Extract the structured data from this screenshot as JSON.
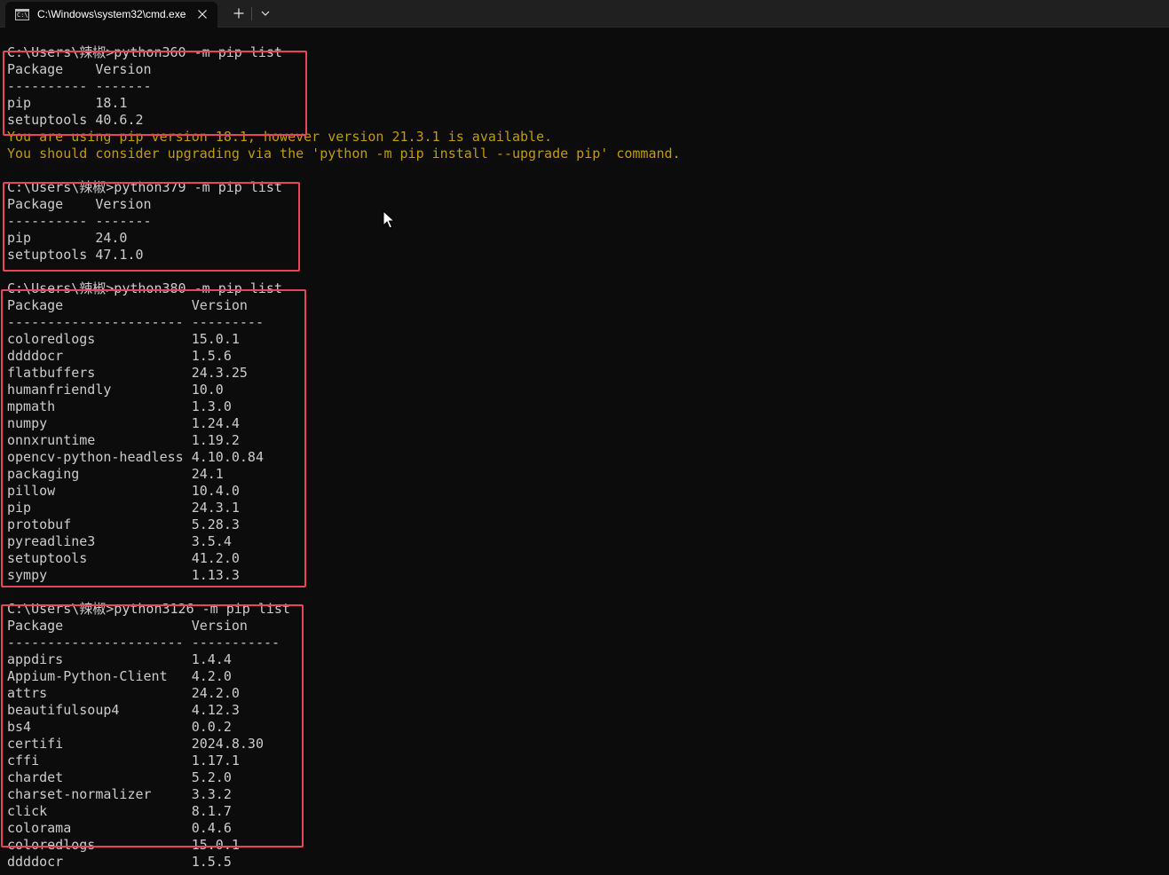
{
  "window": {
    "tab_title": "C:\\Windows\\system32\\cmd.exe"
  },
  "terminal": {
    "lines": [
      "",
      "C:\\Users\\辣椒>python360 -m pip list",
      "Package    Version",
      "---------- -------",
      "pip        18.1",
      "setuptools 40.6.2",
      "You are using pip version 18.1, however version 21.3.1 is available.",
      "You should consider upgrading via the 'python -m pip install --upgrade pip' command.",
      "",
      "C:\\Users\\辣椒>python379 -m pip list",
      "Package    Version",
      "---------- -------",
      "pip        24.0",
      "setuptools 47.1.0",
      "",
      "C:\\Users\\辣椒>python380 -m pip list",
      "Package                Version",
      "---------------------- ---------",
      "coloredlogs            15.0.1",
      "ddddocr                1.5.6",
      "flatbuffers            24.3.25",
      "humanfriendly          10.0",
      "mpmath                 1.3.0",
      "numpy                  1.24.4",
      "onnxruntime            1.19.2",
      "opencv-python-headless 4.10.0.84",
      "packaging              24.1",
      "pillow                 10.4.0",
      "pip                    24.3.1",
      "protobuf               5.28.3",
      "pyreadline3            3.5.4",
      "setuptools             41.2.0",
      "sympy                  1.13.3",
      "",
      "C:\\Users\\辣椒>python3126 -m pip list",
      "Package                Version",
      "---------------------- -----------",
      "appdirs                1.4.4",
      "Appium-Python-Client   4.2.0",
      "attrs                  24.2.0",
      "beautifulsoup4         4.12.3",
      "bs4                    0.0.2",
      "certifi                2024.8.30",
      "cffi                   1.17.1",
      "chardet                5.2.0",
      "charset-normalizer     3.3.2",
      "click                  8.1.7",
      "colorama               0.4.6",
      "coloredlogs            15.0.1",
      "ddddocr                1.5.5"
    ],
    "warning_lines": [
      6,
      7
    ]
  },
  "colors": {
    "background": "#0c0c0c",
    "text": "#cccccc",
    "warning": "#c19c00",
    "highlight_box": "#e8455c",
    "titlebar": "#202020"
  },
  "icons": {
    "tab_icon": "cmd-icon",
    "close": "close-icon",
    "new_tab": "plus-icon",
    "dropdown": "chevron-down-icon",
    "cursor": "mouse-pointer-icon"
  }
}
